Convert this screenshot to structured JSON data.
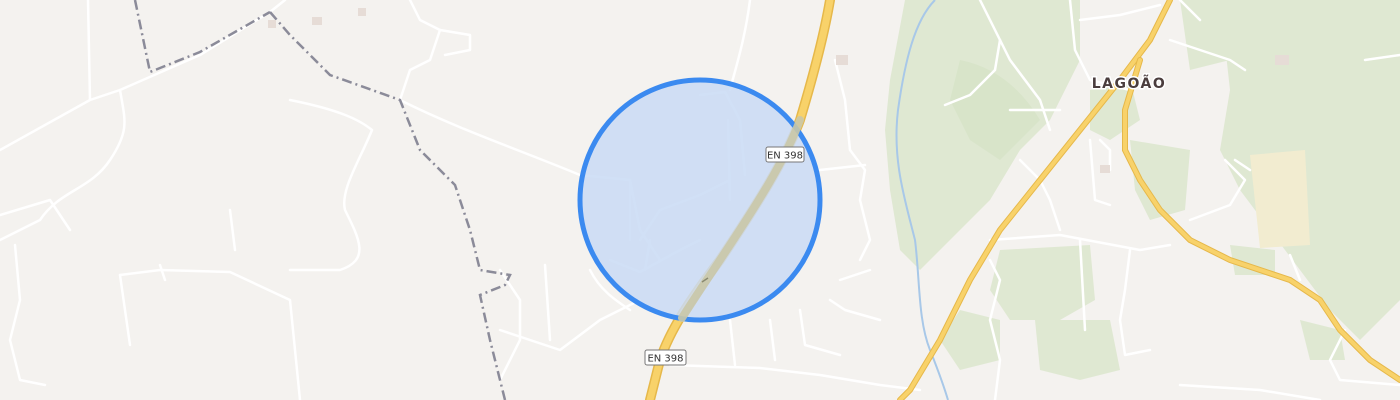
{
  "map": {
    "place_label": "LAGOÃO",
    "road_shields": [
      {
        "id": "shield-1",
        "text": "EN 398"
      },
      {
        "id": "shield-2",
        "text": "EN 398"
      }
    ],
    "location_circle": {
      "radius_m": "approx"
    },
    "colors": {
      "background": "#f4f2ef",
      "vegetation": "#dfe8d2",
      "vegetation_dark": "#d3e1c4",
      "farmland": "#f2ecd0",
      "minor_road": "#ffffff",
      "main_road_fill": "#f8d26a",
      "main_road_casing": "#e6b84a",
      "boundary": "#8b8b99",
      "river": "#a8c8e8",
      "circle_fill": "#c9dbf5",
      "circle_stroke": "#3b8af0",
      "label_text": "#4a3d3d"
    }
  }
}
